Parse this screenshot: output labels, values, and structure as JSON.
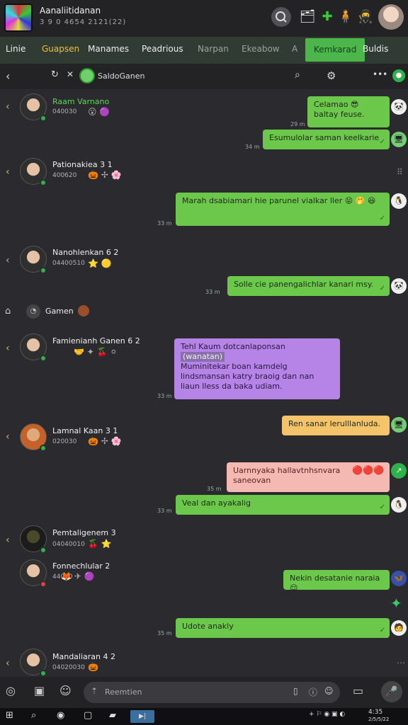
{
  "app": {
    "title": "Aanaliitidanan",
    "subtitle": "3 9 0 4654 2121(22)"
  },
  "menu": {
    "items": [
      "Linie",
      "Guapsen",
      "Manames",
      "Peadrious",
      "Narpan",
      "Ekeabow",
      "A",
      "Kemkarad",
      "Buldis"
    ]
  },
  "chat_header": {
    "title": "SaldoGanen"
  },
  "contacts": [
    {
      "name": "Raam Varnano",
      "meta": "040030",
      "emoji": "😮 🟣",
      "status": "online"
    },
    {
      "name": "Pationakiea 3 1",
      "meta": "400620",
      "emoji": "🎃 ✢ 🌸",
      "status": "online"
    },
    {
      "name": "Nanohlenkan 6 2",
      "meta": "04400510",
      "emoji": "⭐ 🟡",
      "status": "online"
    },
    {
      "name": "Famienianh Ganen 6 2",
      "meta": "0200470",
      "emoji": "🤝 ✦ 🍒 ⚪",
      "status": "online"
    },
    {
      "name": "Lamnal Kaan 3 1",
      "meta": "020030",
      "emoji": "🎃 ✢ 🌸",
      "status": "online"
    },
    {
      "name": "Pemtaligenem 3",
      "meta": "04040010",
      "emoji": "🍒 ⭐",
      "status": "online"
    },
    {
      "name": "Fonnechlular 2",
      "meta": "44000",
      "emoji": "🦊 ✈ 🟣",
      "status": "away"
    },
    {
      "name": "Mandaliaran 4 2",
      "meta": "04020030",
      "emoji": "🎃",
      "status": "online"
    }
  ],
  "group": {
    "label": "Gamen"
  },
  "messages": [
    {
      "text": "Celamao 😎 baltay feuse.",
      "time": "29 m"
    },
    {
      "text": "Esumulolar saman keelkarie",
      "time": "34 m"
    },
    {
      "text": "Marah dsabiamari hie parunel vialkar ller 😝 🤭 😆",
      "time": "33 m"
    },
    {
      "text": "Solle cie panengalichlar kanari msy.",
      "time": "33 m"
    },
    {
      "text": "Tehl Kaum dotcanlaponsan",
      "quote": "(wanatan)",
      "text2": "Muminitekar boan kamdelg lindsmansan katry braoig dan nan liaun lless da baka udiam.",
      "time": "33 m"
    },
    {
      "text": "Ren sanar lerulllanluda.",
      "time": ""
    },
    {
      "text": "Uarnnyaka hallavtnhsnvara saneovan",
      "time": "35 m"
    },
    {
      "text": "Veal dan ayakalig",
      "time": "33 m"
    },
    {
      "text": "Nekin desatanie naraia 😌",
      "time": ""
    },
    {
      "text": "Udote anakly",
      "time": "35 m"
    }
  ],
  "composer": {
    "placeholder": "Reemtien"
  },
  "taskbar": {
    "clock": "4:35",
    "date": "2/5/5/22"
  }
}
